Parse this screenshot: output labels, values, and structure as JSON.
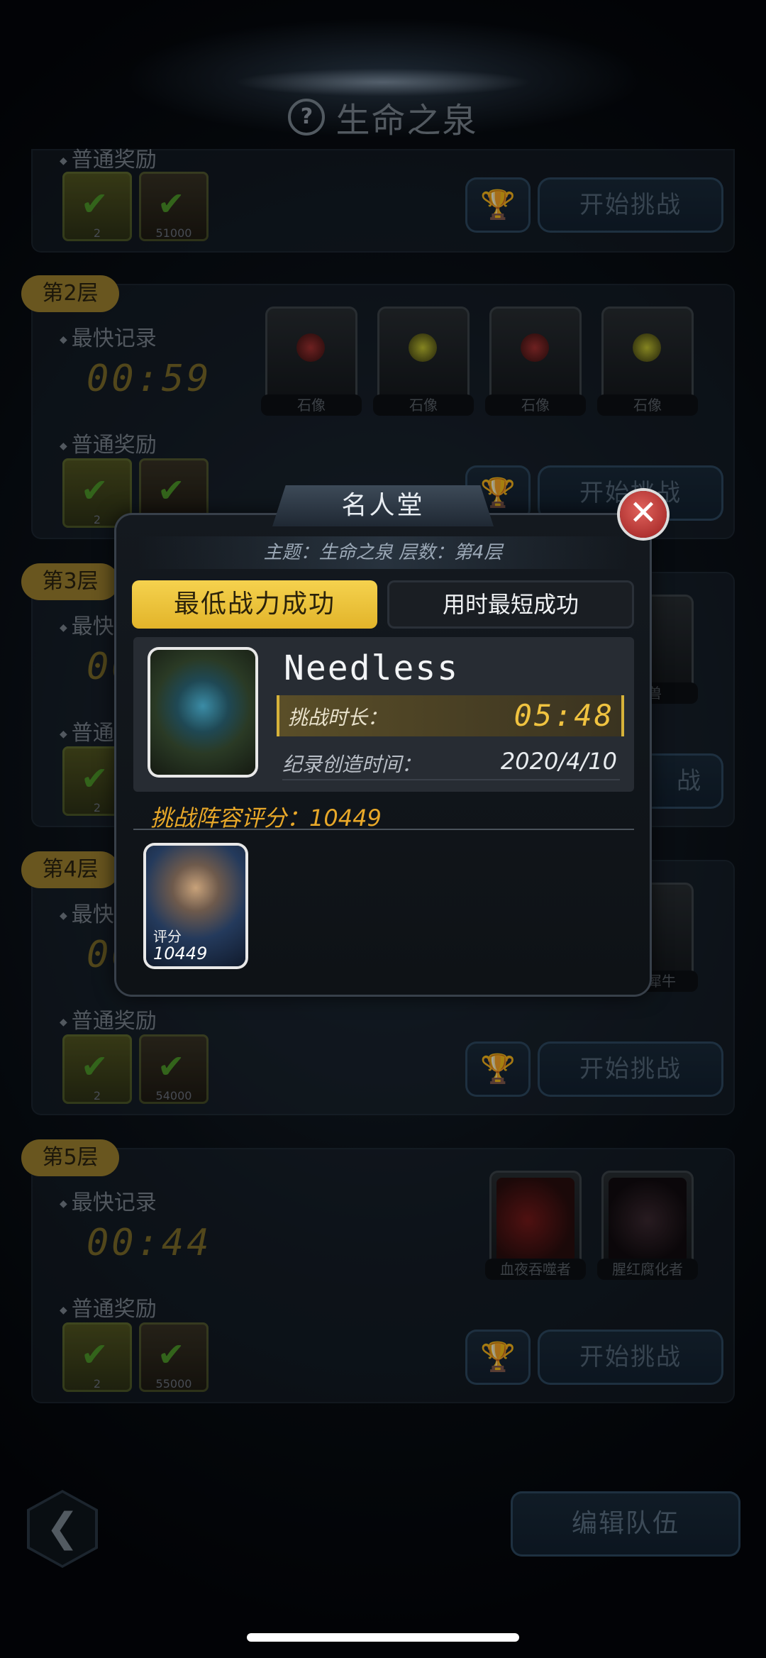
{
  "header": {
    "title": "生命之泉",
    "help_icon": "?"
  },
  "floors": [
    {
      "tag": "",
      "reward_label": "普通奖励",
      "rewards": [
        {
          "qty": "2"
        },
        {
          "qty": "51000"
        }
      ],
      "start_label": "开始挑战"
    },
    {
      "tag": "第2层",
      "record_label": "最快记录",
      "time": "00:59",
      "reward_label": "普通奖励",
      "rewards": [
        {
          "qty": "2"
        },
        {
          "qty": ""
        }
      ],
      "monsters": [
        "石像",
        "石像",
        "石像",
        "石像"
      ],
      "start_label": "开始挑战"
    },
    {
      "tag": "第3层",
      "record_label": "最快",
      "time": "00",
      "reward_label": "普通",
      "rewards": [
        {
          "qty": "2"
        }
      ],
      "monsters": [
        "裂兽"
      ],
      "start_label": "战"
    },
    {
      "tag": "第4层",
      "record_label": "最快",
      "time": "00",
      "reward_label": "普通奖励",
      "rewards": [
        {
          "qty": "2"
        },
        {
          "qty": "54000"
        }
      ],
      "monsters": [
        "异星犀牛"
      ],
      "start_label": "开始挑战"
    },
    {
      "tag": "第5层",
      "record_label": "最快记录",
      "time": "00:44",
      "reward_label": "普通奖励",
      "rewards": [
        {
          "qty": "2"
        },
        {
          "qty": "55000"
        }
      ],
      "monsters": [
        "血夜吞噬者",
        "腥红腐化者"
      ],
      "start_label": "开始挑战"
    }
  ],
  "modal": {
    "title": "名人堂",
    "close": "✕",
    "subtitle": "主题：生命之泉 层数：第4层",
    "tabs": {
      "active": "最低战力成功",
      "inactive": "用时最短成功"
    },
    "record": {
      "player_name": "Needless",
      "duration_label": "挑战时长：",
      "duration_value": "05:48",
      "created_label": "纪录创造时间：",
      "created_value": "2020/4/10"
    },
    "score_label": "挑战阵容评分：10449",
    "hero": {
      "score_label": "评分",
      "score_value": "10449"
    }
  },
  "bottom": {
    "back_icon": "❮",
    "edit_team": "编辑队伍"
  }
}
